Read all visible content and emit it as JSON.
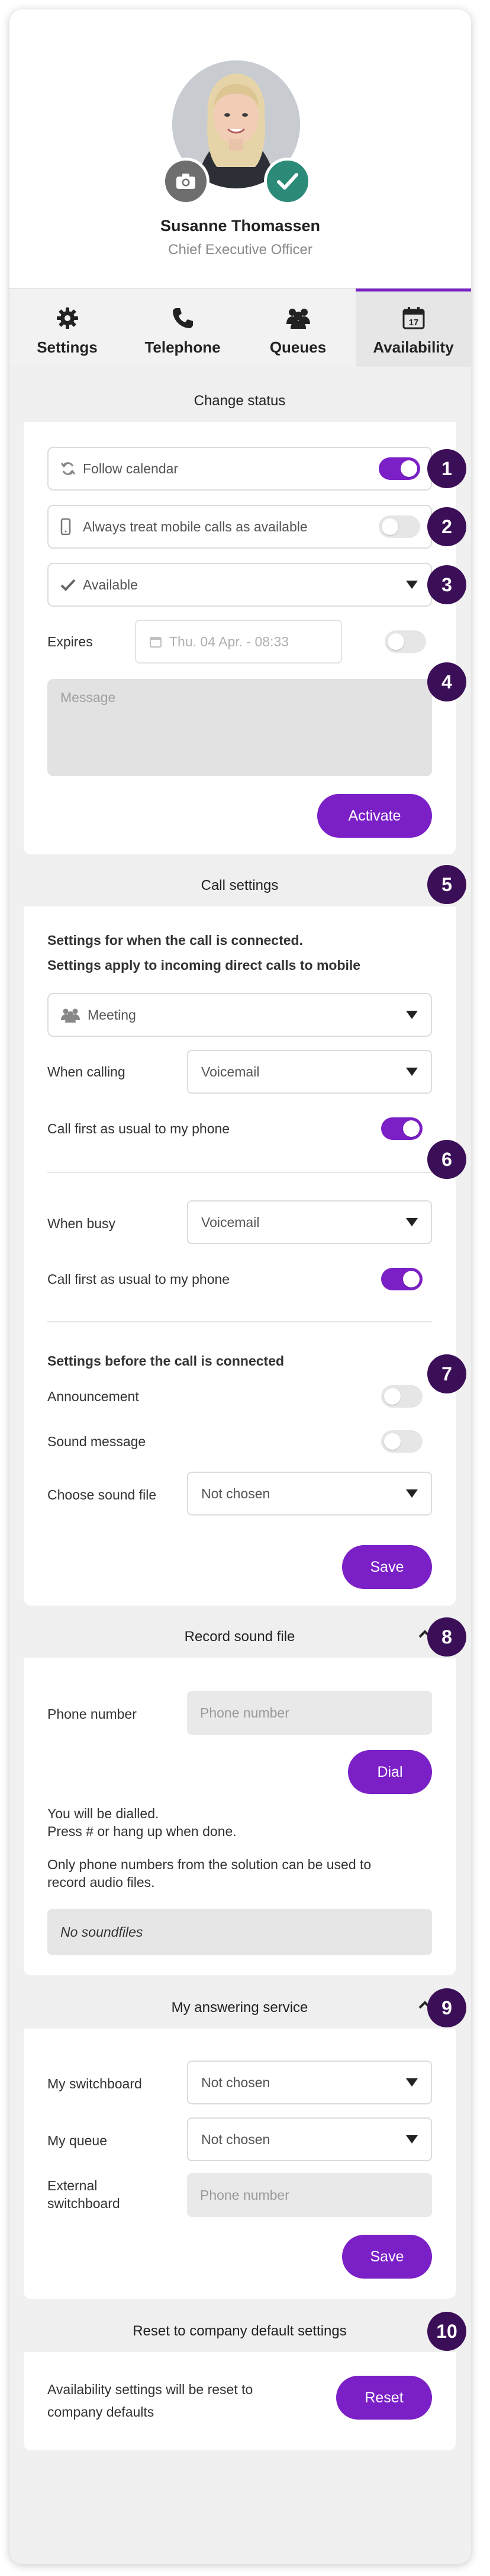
{
  "profile": {
    "name": "Susanne Thomassen",
    "title": "Chief Executive Officer"
  },
  "tabs": [
    {
      "label": "Settings",
      "icon": "gear-icon"
    },
    {
      "label": "Telephone",
      "icon": "phone-icon"
    },
    {
      "label": "Queues",
      "icon": "people-icon"
    },
    {
      "label": "Availability",
      "icon": "calendar-icon",
      "active": true
    }
  ],
  "change_status": {
    "header": "Change status",
    "follow_calendar": {
      "label": "Follow calendar",
      "on": true
    },
    "mobile_available": {
      "label": "Always treat mobile calls as available",
      "on": false
    },
    "status_select": "Available",
    "expires_label": "Expires",
    "expires_placeholder": "Thu. 04 Apr. - 08:33",
    "expires_toggle_on": false,
    "message_placeholder": "Message",
    "activate_label": "Activate"
  },
  "call_settings": {
    "header": "Call settings",
    "intro_line1": "Settings for when the call is connected.",
    "intro_line2": "Settings apply to incoming direct calls to mobile",
    "profile_select": "Meeting",
    "when_calling_label": "When calling",
    "when_calling_value": "Voicemail",
    "call_first_label_1": "Call first as usual to my phone",
    "call_first_on_1": true,
    "when_busy_label": "When busy",
    "when_busy_value": "Voicemail",
    "call_first_label_2": "Call first as usual to my phone",
    "call_first_on_2": true,
    "before_heading": "Settings before the call is connected",
    "announcement_label": "Announcement",
    "announcement_on": false,
    "sound_message_label": "Sound message",
    "sound_message_on": false,
    "choose_sound_label": "Choose sound file",
    "choose_sound_value": "Not chosen",
    "save_label": "Save"
  },
  "record_sound": {
    "header": "Record sound file",
    "phone_label": "Phone number",
    "phone_placeholder": "Phone number",
    "dial_label": "Dial",
    "info_line1": "You will be dialled.",
    "info_line2": "Press # or hang up when done.",
    "info_line3": "Only phone numbers from the solution can be used to",
    "info_line4": "record audio files.",
    "no_soundfiles": "No soundfiles"
  },
  "answering_service": {
    "header": "My answering service",
    "switchboard_label": "My switchboard",
    "switchboard_value": "Not chosen",
    "queue_label": "My queue",
    "queue_value": "Not chosen",
    "external_label_1": "External",
    "external_label_2": "switchboard",
    "external_placeholder": "Phone number",
    "save_label": "Save"
  },
  "reset": {
    "header": "Reset to company default settings",
    "text_line1": "Availability settings will be reset to",
    "text_line2": "company defaults",
    "reset_label": "Reset"
  },
  "markers": [
    "1",
    "2",
    "3",
    "4",
    "5",
    "6",
    "7",
    "8",
    "9",
    "10"
  ],
  "colors": {
    "accent": "#7b1fc7",
    "marker": "#3b0f57",
    "ok_badge": "#2b8a78"
  }
}
